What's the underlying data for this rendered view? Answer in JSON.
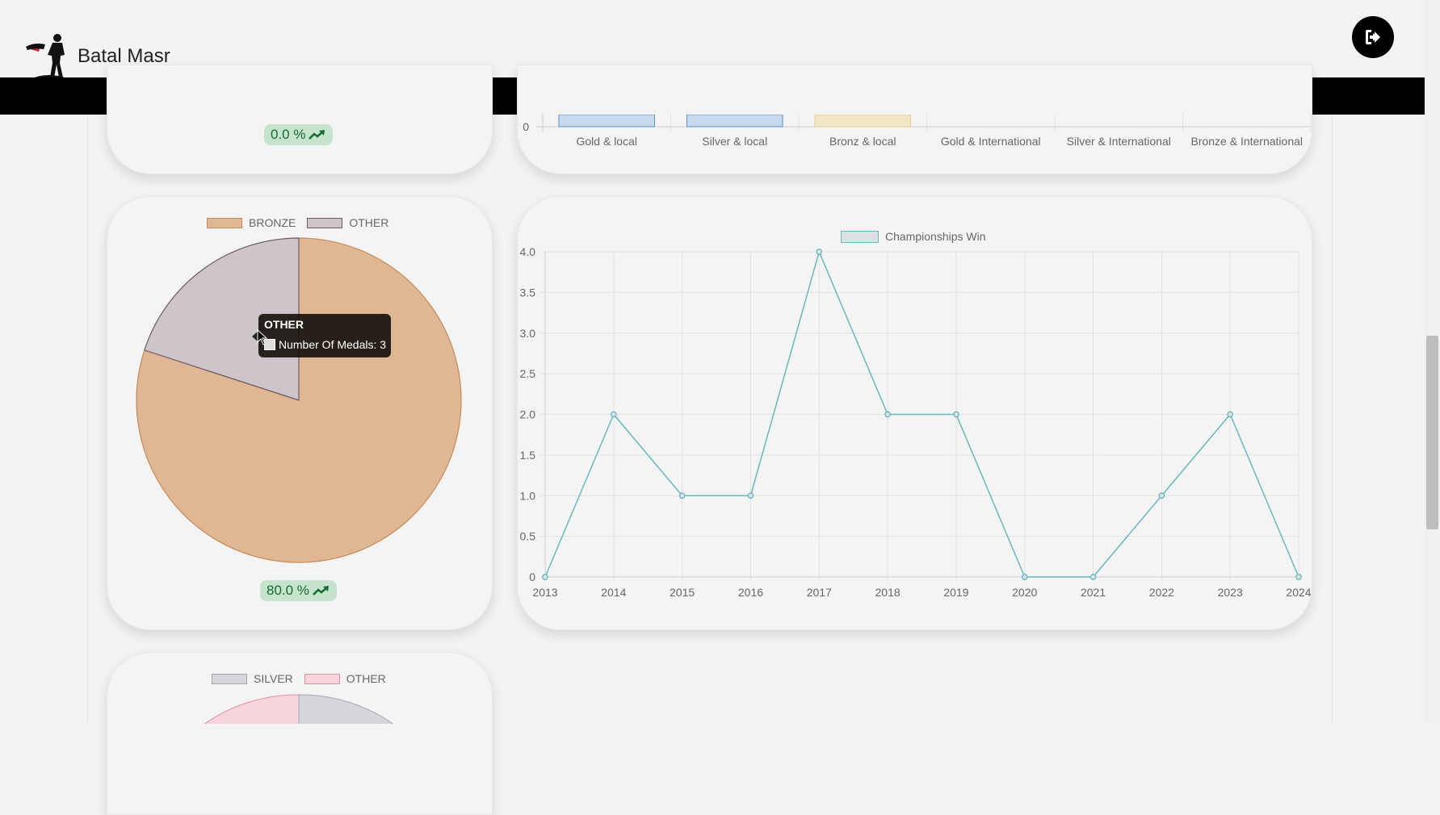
{
  "header": {
    "app_name": "Batal Masr",
    "logout_icon": "logout-icon"
  },
  "top_card": {
    "percent_badge": "0.0 %"
  },
  "bar_chart": {
    "chart_data": {
      "type": "bar",
      "categories": [
        "Gold & local",
        "Silver & local",
        "Bronz & local",
        "Gold & International",
        "Silver & International",
        "Bronze & International"
      ],
      "ytick_visible": "0",
      "bar_colors": [
        "#c7dbef",
        "#c7dbef",
        "#f1e6c8",
        "#ffffff",
        "#ffffff",
        "#ffffff"
      ]
    }
  },
  "bronze_card": {
    "legend": [
      {
        "label": "BRONZE",
        "color": "#dfb794",
        "border": "#c58b58"
      },
      {
        "label": "OTHER",
        "color": "#cdc5ca",
        "border": "#6f5b66"
      }
    ],
    "chart_data": {
      "type": "pie",
      "labels": [
        "BRONZE",
        "OTHER"
      ],
      "values": [
        12,
        3
      ]
    },
    "tooltip": {
      "title": "OTHER",
      "line": "Number Of Medals: 3"
    },
    "percent_badge": "80.0 %"
  },
  "line_card": {
    "chart_data": {
      "type": "line",
      "x": [
        "2013",
        "2014",
        "2015",
        "2016",
        "2017",
        "2018",
        "2019",
        "2020",
        "2021",
        "2022",
        "2023",
        "2024"
      ],
      "series": [
        {
          "name": "Championships Win",
          "values": [
            0,
            2,
            1,
            1,
            4,
            2,
            2,
            0,
            0,
            1,
            2,
            0
          ]
        }
      ],
      "yticks": [
        "0",
        "0.5",
        "1.0",
        "1.5",
        "2.0",
        "2.5",
        "3.0",
        "3.5",
        "4.0"
      ],
      "ylim": [
        0,
        4
      ],
      "grid": true,
      "line_color": "#68b8bc",
      "legend_position": "top"
    }
  },
  "silver_card": {
    "legend": [
      {
        "label": "SILVER",
        "color": "#d7d5dc",
        "border": "#a9a6b0"
      },
      {
        "label": "OTHER",
        "color": "#f6d5dd",
        "border": "#e48fa6"
      }
    ]
  }
}
